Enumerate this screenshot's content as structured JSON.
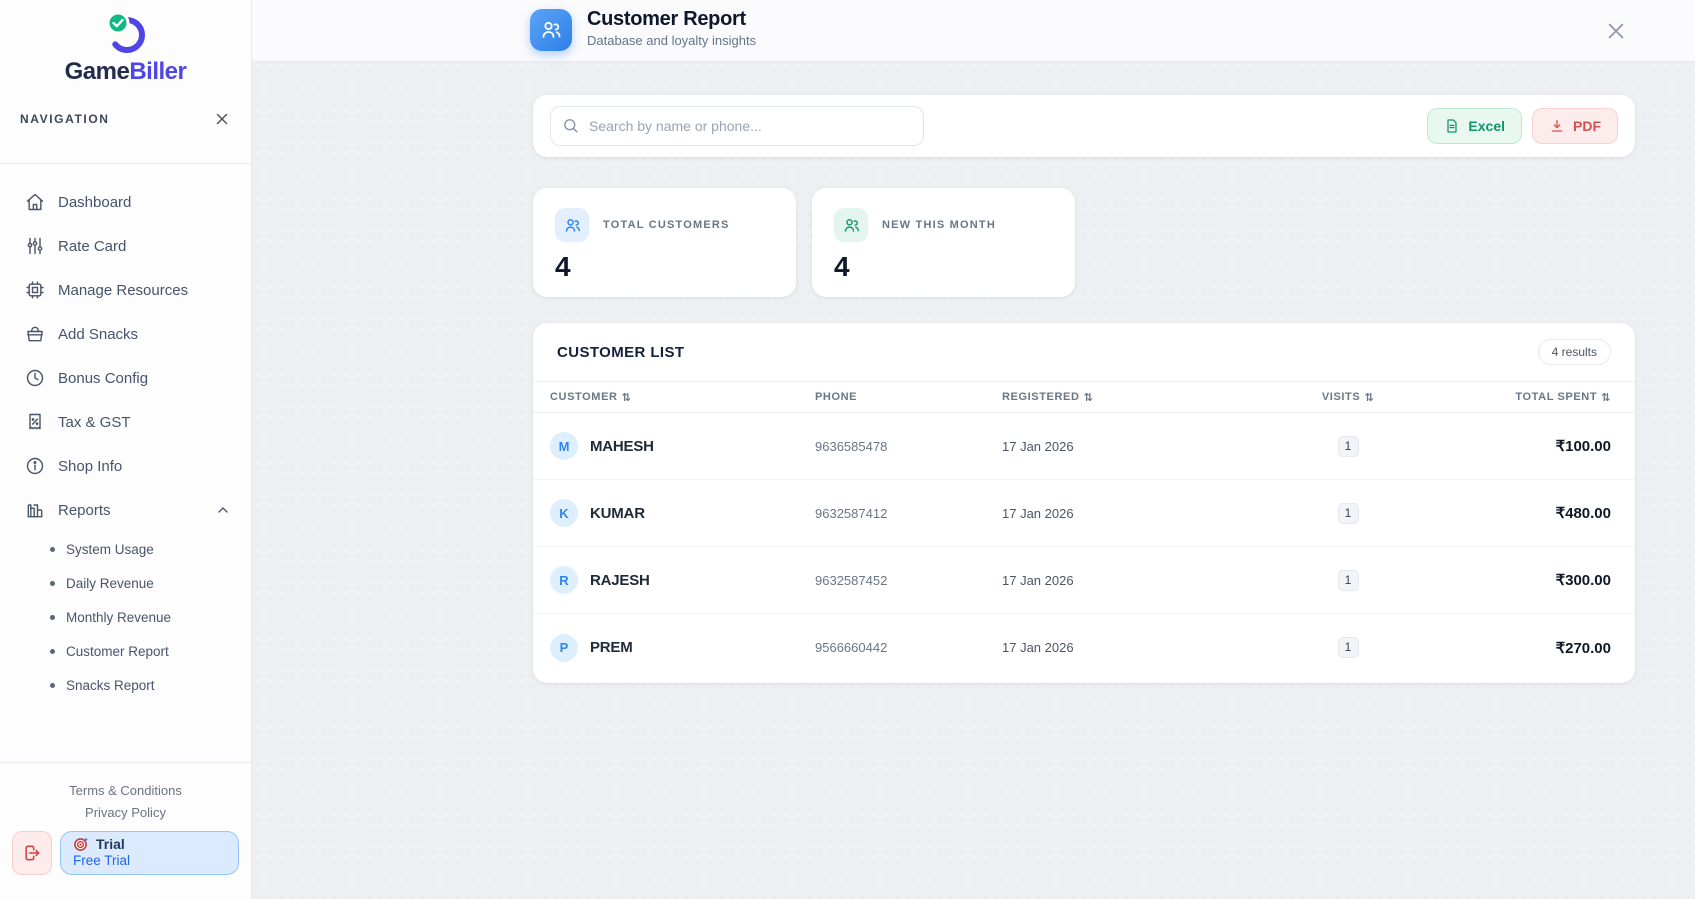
{
  "brand": {
    "part1": "Game",
    "part2": "Biller"
  },
  "colors": {
    "indigo": "#4f46e5",
    "blue": "#2f86eb",
    "green": "#10b981",
    "excel_green": "#13946d",
    "pdf_red": "#d45050",
    "trial_blue": "#2563eb"
  },
  "sidebar": {
    "section_label": "NAVIGATION",
    "items": [
      {
        "label": "Dashboard",
        "icon": "home-icon"
      },
      {
        "label": "Rate Card",
        "icon": "sliders-icon"
      },
      {
        "label": "Manage Resources",
        "icon": "chip-icon"
      },
      {
        "label": "Add Snacks",
        "icon": "basket-icon"
      },
      {
        "label": "Bonus Config",
        "icon": "clock-icon"
      },
      {
        "label": "Tax & GST",
        "icon": "receipt-icon"
      },
      {
        "label": "Shop Info",
        "icon": "info-icon"
      },
      {
        "label": "Reports",
        "icon": "bar-chart-icon",
        "expanded": true
      }
    ],
    "report_subitems": [
      {
        "label": "System Usage"
      },
      {
        "label": "Daily Revenue"
      },
      {
        "label": "Monthly Revenue"
      },
      {
        "label": "Customer Report"
      },
      {
        "label": "Snacks Report"
      }
    ],
    "footer": {
      "terms": "Terms & Conditions",
      "privacy": "Privacy Policy",
      "plan_name": "Trial",
      "plan_detail": "Free Trial"
    }
  },
  "header": {
    "title": "Customer Report",
    "subtitle": "Database and loyalty insights"
  },
  "toolbar": {
    "search_placeholder": "Search by name or phone...",
    "excel_label": "Excel",
    "pdf_label": "PDF"
  },
  "stats": [
    {
      "label": "TOTAL CUSTOMERS",
      "value": "4"
    },
    {
      "label": "NEW THIS MONTH",
      "value": "4"
    }
  ],
  "customer_list": {
    "title": "CUSTOMER LIST",
    "results_badge": "4 results",
    "columns": [
      {
        "label": "CUSTOMER",
        "sortable": true
      },
      {
        "label": "PHONE",
        "sortable": false
      },
      {
        "label": "REGISTERED",
        "sortable": true
      },
      {
        "label": "VISITS",
        "sortable": true
      },
      {
        "label": "TOTAL SPENT",
        "sortable": true
      }
    ],
    "rows": [
      {
        "initial": "M",
        "name": "MAHESH",
        "phone": "9636585478",
        "registered": "17 Jan 2026",
        "visits": "1",
        "total": "₹100.00"
      },
      {
        "initial": "K",
        "name": "KUMAR",
        "phone": "9632587412",
        "registered": "17 Jan 2026",
        "visits": "1",
        "total": "₹480.00"
      },
      {
        "initial": "R",
        "name": "RAJESH",
        "phone": "9632587452",
        "registered": "17 Jan 2026",
        "visits": "1",
        "total": "₹300.00"
      },
      {
        "initial": "P",
        "name": "PREM",
        "phone": "9566660442",
        "registered": "17 Jan 2026",
        "visits": "1",
        "total": "₹270.00"
      }
    ]
  }
}
